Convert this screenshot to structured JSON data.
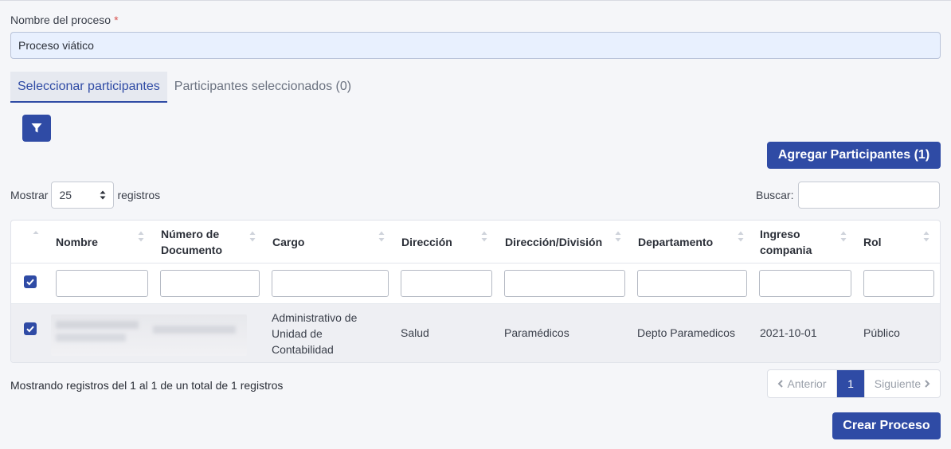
{
  "form": {
    "label": "Nombre del proceso",
    "required_mark": "*",
    "value": "Proceso viático"
  },
  "tabs": [
    {
      "label": "Seleccionar participantes",
      "active": true
    },
    {
      "label": "Participantes seleccionados (0)",
      "active": false
    }
  ],
  "toolbar": {
    "filter_icon": "filter-icon",
    "add_label": "Agregar Participantes (1)"
  },
  "length_control": {
    "prefix": "Mostrar",
    "value": "25",
    "suffix": "registros"
  },
  "search": {
    "label": "Buscar:",
    "value": ""
  },
  "table": {
    "columns": [
      {
        "label": "Nombre"
      },
      {
        "label": "Número de Documento"
      },
      {
        "label": "Cargo"
      },
      {
        "label": "Dirección"
      },
      {
        "label": "Dirección/División"
      },
      {
        "label": "Departamento"
      },
      {
        "label": "Ingreso compania"
      },
      {
        "label": "Rol"
      }
    ],
    "rows": [
      {
        "selected": true,
        "cargo": "Administrativo de Unidad de Contabilidad",
        "direccion": "Salud",
        "division": "Paramédicos",
        "departamento": "Depto Paramedicos",
        "ingreso": "2021-10-01",
        "rol": "Público"
      }
    ]
  },
  "footer": {
    "info": "Mostrando registros del 1 al 1 de un total de 1 registros",
    "prev": "Anterior",
    "page": "1",
    "next": "Siguiente",
    "create_label": "Crear Proceso"
  },
  "colors": {
    "primary": "#2f4ba5",
    "input_bg": "#e8f0fe",
    "row_selected": "#eeeff3",
    "required": "#d9534f"
  }
}
